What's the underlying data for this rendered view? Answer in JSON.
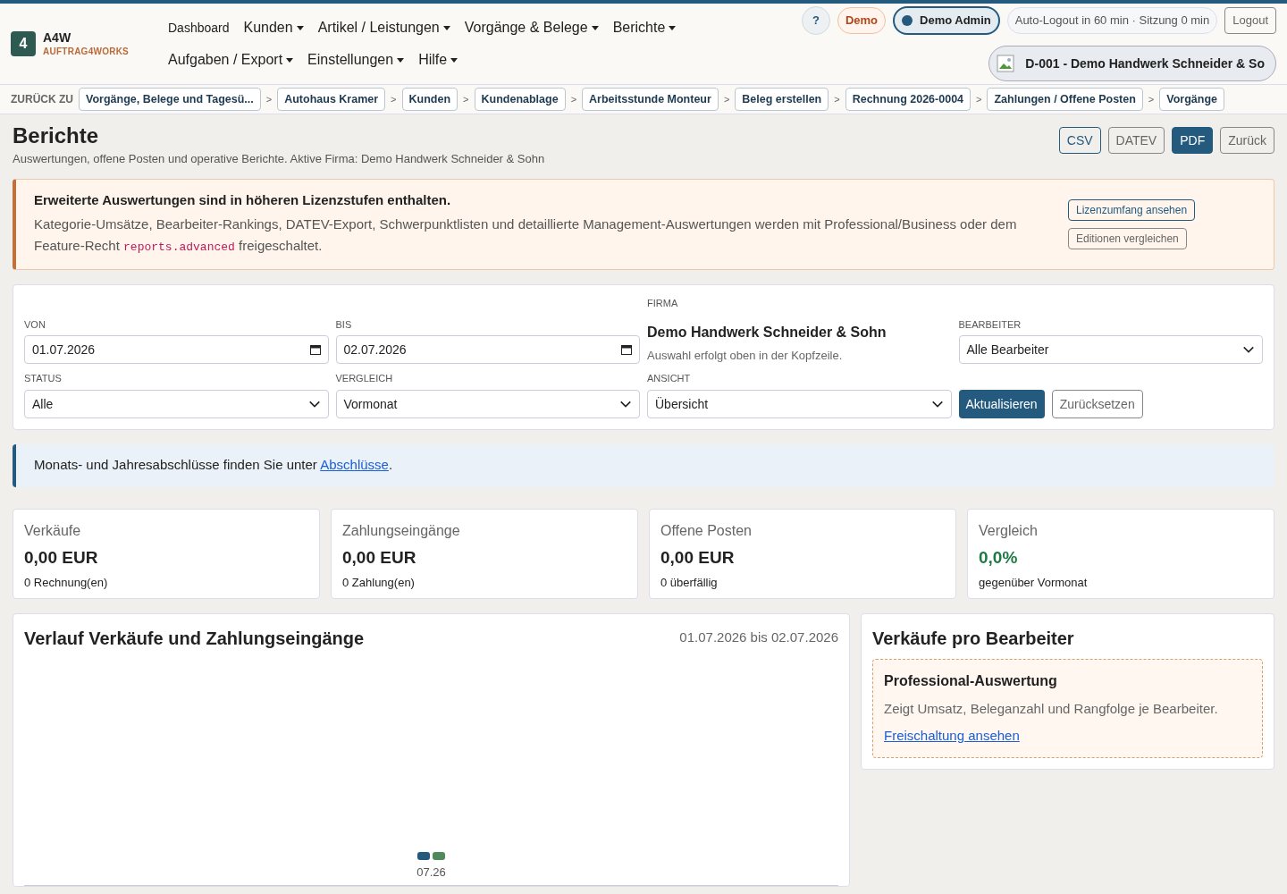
{
  "brand": {
    "badge": "4",
    "name": "A4W",
    "subtitle": "AUFTRAG4WORKS"
  },
  "nav": [
    {
      "label": "Dashboard",
      "dropdown": false
    },
    {
      "label": "Kunden",
      "dropdown": true
    },
    {
      "label": "Artikel / Leistungen",
      "dropdown": true
    },
    {
      "label": "Vorgänge & Belege",
      "dropdown": true
    },
    {
      "label": "Berichte",
      "dropdown": true
    },
    {
      "label": "Aufgaben / Export",
      "dropdown": true
    },
    {
      "label": "Einstellungen",
      "dropdown": true
    },
    {
      "label": "Hilfe",
      "dropdown": true
    }
  ],
  "header": {
    "help": "?",
    "mode_badge": "Demo",
    "user": "Demo Admin",
    "session": "Auto-Logout in 60 min · Sitzung 0 min",
    "logout": "Logout",
    "company": "D-001 - Demo Handwerk Schneider & So"
  },
  "breadcrumbs": {
    "label": "ZURÜCK ZU",
    "separator": ">",
    "items": [
      "Vorgänge, Belege und Tagesü...",
      "Autohaus Kramer",
      "Kunden",
      "Kundenablage",
      "Arbeitsstunde Monteur",
      "Beleg erstellen",
      "Rechnung 2026-0004",
      "Zahlungen / Offene Posten",
      "Vorgänge"
    ]
  },
  "page": {
    "title": "Berichte",
    "subtitle": "Auswertungen, offene Posten und operative Berichte. Aktive Firma: Demo Handwerk Schneider & Sohn",
    "actions": [
      {
        "label": "CSV",
        "kind": "outline"
      },
      {
        "label": "DATEV",
        "kind": "muted"
      },
      {
        "label": "PDF",
        "kind": "primary"
      },
      {
        "label": "Zurück",
        "kind": "muted"
      }
    ]
  },
  "license_notice": {
    "title": "Erweiterte Auswertungen sind in höheren Lizenzstufen enthalten.",
    "text_before": "Kategorie-Umsätze, Bearbeiter-Rankings, DATEV-Export, Schwerpunktlisten und detaillierte Management-Auswertungen werden mit Professional/Business oder dem Feature-Recht",
    "code": "reports.advanced",
    "text_after": "freigeschaltet.",
    "buttons": [
      {
        "label": "Lizenzumfang ansehen",
        "kind": "outline"
      },
      {
        "label": "Editionen vergleichen",
        "kind": "muted"
      }
    ]
  },
  "filters": {
    "von": {
      "label": "VON",
      "value": "01.07.2026"
    },
    "bis": {
      "label": "BIS",
      "value": "02.07.2026"
    },
    "firma": {
      "label": "FIRMA",
      "name": "Demo Handwerk Schneider & Sohn",
      "hint": "Auswahl erfolgt oben in der Kopfzeile."
    },
    "bearbeiter": {
      "label": "BEARBEITER",
      "value": "Alle Bearbeiter"
    },
    "status": {
      "label": "STATUS",
      "value": "Alle"
    },
    "vergleich": {
      "label": "VERGLEICH",
      "value": "Vormonat"
    },
    "ansicht": {
      "label": "ANSICHT",
      "value": "Übersicht"
    },
    "apply": "Aktualisieren",
    "reset": "Zurücksetzen"
  },
  "info": {
    "text": "Monats- und Jahresabschlüsse finden Sie unter",
    "link": "Abschlüsse",
    "end": "."
  },
  "kpis": [
    {
      "label": "Verkäufe",
      "value": "0,00 EUR",
      "note": "0 Rechnung(en)",
      "positive": false
    },
    {
      "label": "Zahlungseingänge",
      "value": "0,00 EUR",
      "note": "0 Zahlung(en)",
      "positive": false
    },
    {
      "label": "Offene Posten",
      "value": "0,00 EUR",
      "note": "0 überfällig",
      "positive": false
    },
    {
      "label": "Vergleich",
      "value": "0,0%",
      "note": "gegenüber Vormonat",
      "positive": true
    }
  ],
  "trend": {
    "title": "Verlauf Verkäufe und Zahlungseingänge",
    "range": "01.07.2026 bis 02.07.2026",
    "axis_label": "07.26"
  },
  "per_user": {
    "title": "Verkäufe pro Bearbeiter",
    "upsell_title": "Professional-Auswertung",
    "upsell_text": "Zeigt Umsatz, Beleganzahl und Rangfolge je Bearbeiter.",
    "upsell_link": "Freischaltung ansehen"
  }
}
